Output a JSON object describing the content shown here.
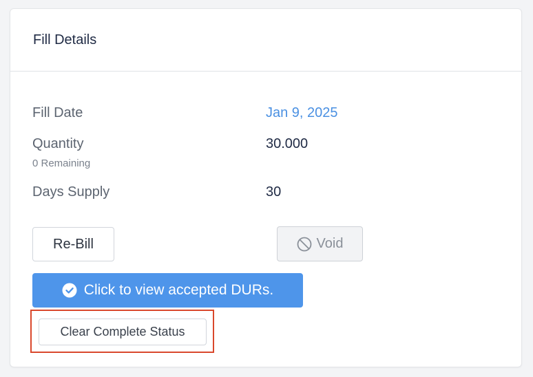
{
  "panel": {
    "title": "Fill Details"
  },
  "fields": {
    "fill_date": {
      "label": "Fill Date",
      "value": "Jan 9, 2025"
    },
    "quantity": {
      "label": "Quantity",
      "sublabel": "0 Remaining",
      "value": "30.000"
    },
    "days_supply": {
      "label": "Days Supply",
      "value": "30"
    }
  },
  "actions": {
    "rebill_label": "Re-Bill",
    "void_label": "Void",
    "durs_label": "Click to view accepted DURs.",
    "clear_status_label": "Clear Complete Status"
  },
  "icons": {
    "void": "prohibited-icon",
    "durs": "check-circle-icon"
  },
  "colors": {
    "link": "#4a90e2",
    "primary": "#4e95ea",
    "highlight": "#d9472b"
  }
}
